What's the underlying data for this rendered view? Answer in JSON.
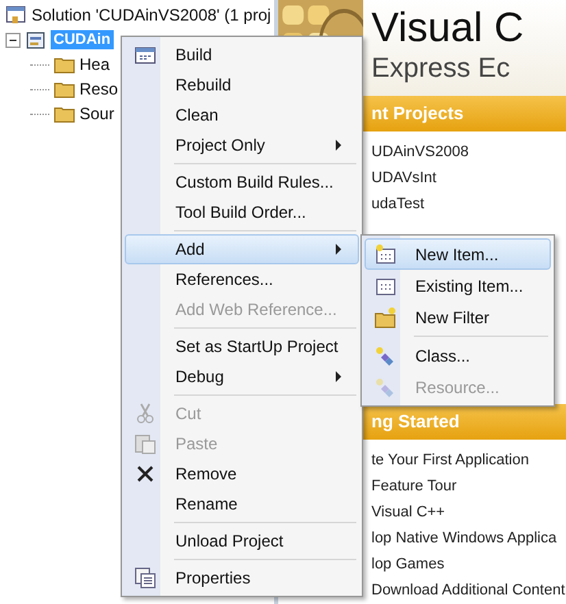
{
  "solution_explorer": {
    "solution": "Solution 'CUDAinVS2008' (1 proj",
    "project": {
      "label": "CUDAin",
      "selected": true,
      "expanded": true,
      "children": [
        {
          "label": "Hea"
        },
        {
          "label": "Reso"
        },
        {
          "label": "Sour"
        }
      ]
    }
  },
  "start_page": {
    "product_name": "Visual C",
    "edition": "Express Ec",
    "recent_projects": {
      "title": "nt Projects",
      "items": [
        "UDAinVS2008",
        "UDAVsInt",
        "udaTest"
      ]
    },
    "getting_started": {
      "title": "ng Started",
      "items": [
        "te Your First Application",
        "Feature Tour",
        "Visual C++",
        "lop Native Windows Applica",
        "lop Games",
        "Download Additional Content"
      ]
    }
  },
  "context_menu": [
    {
      "kind": "item",
      "label": "Build",
      "disabled": false,
      "submenu": false,
      "selected": false
    },
    {
      "kind": "item",
      "label": "Rebuild",
      "disabled": false,
      "submenu": false,
      "selected": false
    },
    {
      "kind": "item",
      "label": "Clean",
      "disabled": false,
      "submenu": false,
      "selected": false
    },
    {
      "kind": "item",
      "label": "Project Only",
      "disabled": false,
      "submenu": true,
      "selected": false
    },
    {
      "kind": "separator"
    },
    {
      "kind": "item",
      "label": "Custom Build Rules...",
      "disabled": false,
      "submenu": false,
      "selected": false
    },
    {
      "kind": "item",
      "label": "Tool Build Order...",
      "disabled": false,
      "submenu": false,
      "selected": false
    },
    {
      "kind": "separator"
    },
    {
      "kind": "item",
      "label": "Add",
      "disabled": false,
      "submenu": true,
      "selected": true
    },
    {
      "kind": "item",
      "label": "References...",
      "disabled": false,
      "submenu": false,
      "selected": false
    },
    {
      "kind": "item",
      "label": "Add Web Reference...",
      "disabled": true,
      "submenu": false,
      "selected": false
    },
    {
      "kind": "separator"
    },
    {
      "kind": "item",
      "label": "Set as StartUp Project",
      "disabled": false,
      "submenu": false,
      "selected": false
    },
    {
      "kind": "item",
      "label": "Debug",
      "disabled": false,
      "submenu": true,
      "selected": false
    },
    {
      "kind": "separator"
    },
    {
      "kind": "item",
      "label": "Cut",
      "disabled": true,
      "submenu": false,
      "selected": false
    },
    {
      "kind": "item",
      "label": "Paste",
      "disabled": true,
      "submenu": false,
      "selected": false
    },
    {
      "kind": "item",
      "label": "Remove",
      "disabled": false,
      "submenu": false,
      "selected": false
    },
    {
      "kind": "item",
      "label": "Rename",
      "disabled": false,
      "submenu": false,
      "selected": false
    },
    {
      "kind": "separator"
    },
    {
      "kind": "item",
      "label": "Unload Project",
      "disabled": false,
      "submenu": false,
      "selected": false
    },
    {
      "kind": "separator"
    },
    {
      "kind": "item",
      "label": "Properties",
      "disabled": false,
      "submenu": false,
      "selected": false
    }
  ],
  "add_submenu": [
    {
      "kind": "item",
      "label": "New Item...",
      "disabled": false,
      "selected": true
    },
    {
      "kind": "item",
      "label": "Existing Item...",
      "disabled": false,
      "selected": false
    },
    {
      "kind": "item",
      "label": "New Filter",
      "disabled": false,
      "selected": false
    },
    {
      "kind": "separator"
    },
    {
      "kind": "item",
      "label": "Class...",
      "disabled": false,
      "selected": false
    },
    {
      "kind": "item",
      "label": "Resource...",
      "disabled": true,
      "selected": false
    }
  ]
}
